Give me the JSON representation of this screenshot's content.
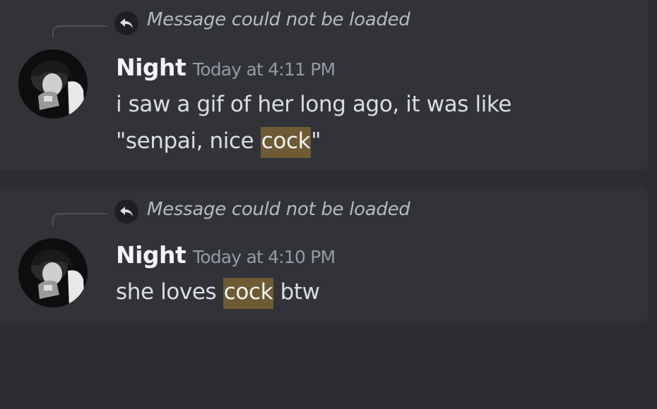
{
  "results": [
    {
      "reply_text": "Message could not be loaded",
      "author": "Night",
      "timestamp": "Today at 4:11 PM",
      "lines": [
        {
          "before": "i saw a gif of her long ago, it was like",
          "match": "",
          "after": ""
        },
        {
          "before": "\"senpai, nice ",
          "match": "cock",
          "after": "\""
        }
      ]
    },
    {
      "reply_text": "Message could not be loaded",
      "author": "Night",
      "timestamp": "Today at 4:10 PM",
      "lines": [
        {
          "before": "she loves ",
          "match": "cock",
          "after": " btw"
        }
      ]
    }
  ],
  "colors": {
    "background": "#2b2d31",
    "card": "#313338",
    "highlight": "#6e5a34"
  }
}
